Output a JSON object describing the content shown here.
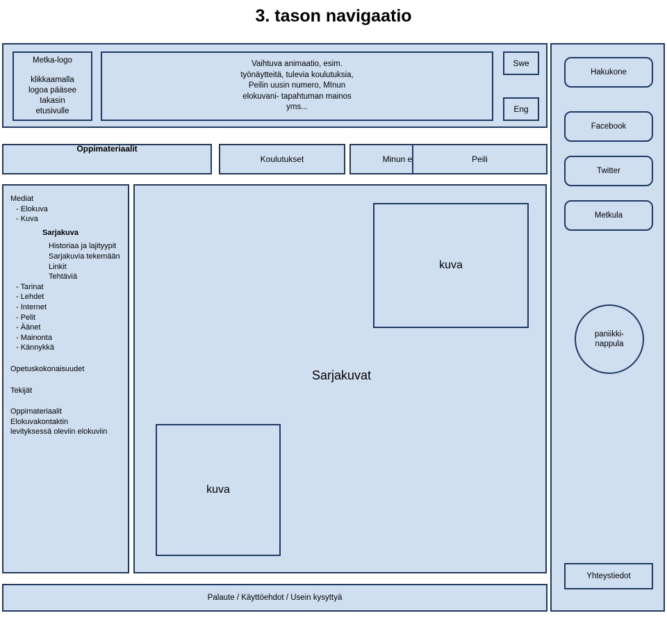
{
  "page": {
    "title": "3. tason navigaatio"
  },
  "header": {
    "logo_box": {
      "line1": "Metka-logo",
      "line2": "klikkaamalla",
      "line3": "logoa pääsee",
      "line4": "takasin",
      "line5": "etusivulle"
    },
    "animation_box": {
      "line1": "Vaihtuva animaatio, esim.",
      "line2": "työnäytteitä, tulevia koulutuksia,",
      "line3": "Peilin uusin numero, MInun",
      "line4": "elokuvani- tapahtuman mainos",
      "line5": "yms..."
    },
    "language_buttons": [
      {
        "label": "Swe"
      },
      {
        "label": "Eng"
      }
    ]
  },
  "nav_tabs": [
    {
      "label": "Oppimateriaalit",
      "active": true
    },
    {
      "label": "Koulutukset",
      "active": false
    },
    {
      "label": "Minun elokuvani",
      "active": false
    },
    {
      "label": "Peili",
      "active": false
    }
  ],
  "sidebar": {
    "items": [
      {
        "label": "Mediat",
        "level": 0
      },
      {
        "label": "- Elokuva",
        "level": 1
      },
      {
        "label": "- Kuva",
        "level": 1
      },
      {
        "label": "Sarjakuva",
        "level": "bold"
      },
      {
        "label": "Historiaa ja lajityypit",
        "level": 2
      },
      {
        "label": "Sarjakuvia tekemään",
        "level": 2
      },
      {
        "label": "Linkit",
        "level": 2
      },
      {
        "label": "Tehtäviä",
        "level": 2
      },
      {
        "label": "- Tarinat",
        "level": 1
      },
      {
        "label": "- Lehdet",
        "level": 1
      },
      {
        "label": "- Internet",
        "level": 1
      },
      {
        "label": "- Pelit",
        "level": 1
      },
      {
        "label": "- Äänet",
        "level": 1
      },
      {
        "label": "- Mainonta",
        "level": 1
      },
      {
        "label": "- Kännykkä",
        "level": 1
      },
      {
        "label": "",
        "level": "gap"
      },
      {
        "label": "Opetuskokonaisuudet",
        "level": 0
      },
      {
        "label": "",
        "level": "gap"
      },
      {
        "label": "Tekijät",
        "level": 0
      },
      {
        "label": "",
        "level": "gap"
      },
      {
        "label": "Oppimateriaalit",
        "level": 0
      },
      {
        "label": "Elokuvakontaktin",
        "level": 0
      },
      {
        "label": "levityksessä oleviin elokuviin",
        "level": 0
      }
    ]
  },
  "main": {
    "image_top_label": "kuva",
    "section_label": "Sarjakuvat",
    "image_bottom_label": "kuva"
  },
  "right_rail": {
    "buttons": [
      {
        "label": "Hakukone"
      },
      {
        "label": "Facebook"
      },
      {
        "label": "Twitter"
      },
      {
        "label": "Metkula"
      }
    ],
    "panic_button": {
      "line1": "paniikki-",
      "line2": "nappula"
    },
    "contact_button": {
      "label": "Yhteystiedot"
    }
  },
  "footer": {
    "links": "Palaute / Käyttöehdot / Usein kysyttyä"
  },
  "colors": {
    "fill": "#cfdfef",
    "border": "#1f3864",
    "page_background": "#ffffff",
    "text": "#000000"
  }
}
